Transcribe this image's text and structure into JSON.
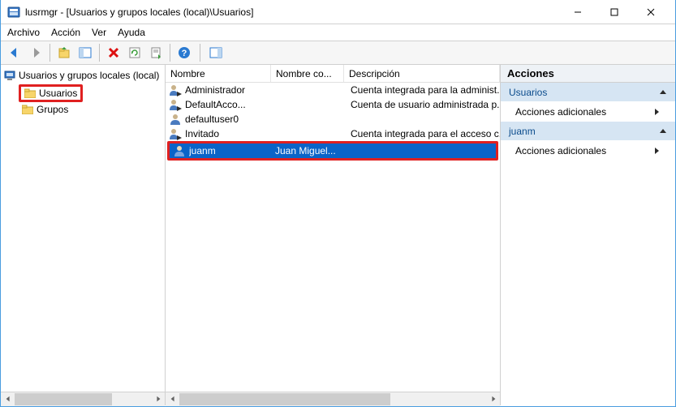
{
  "window": {
    "title": "lusrmgr - [Usuarios y grupos locales (local)\\Usuarios]"
  },
  "menu": {
    "file": "Archivo",
    "action": "Acción",
    "view": "Ver",
    "help": "Ayuda"
  },
  "tree": {
    "root": "Usuarios y grupos locales (local)",
    "users": "Usuarios",
    "groups": "Grupos"
  },
  "list": {
    "columns": {
      "name": "Nombre",
      "fullname": "Nombre co...",
      "description": "Descripción"
    },
    "rows": [
      {
        "name": "Administrador",
        "fullname": "",
        "description": "Cuenta integrada para la administ..",
        "icon": "user-down"
      },
      {
        "name": "DefaultAcco...",
        "fullname": "",
        "description": "Cuenta de usuario administrada p..",
        "icon": "user-down"
      },
      {
        "name": "defaultuser0",
        "fullname": "",
        "description": "",
        "icon": "user"
      },
      {
        "name": "Invitado",
        "fullname": "",
        "description": "Cuenta integrada para el acceso c..",
        "icon": "user-down"
      },
      {
        "name": "juanm",
        "fullname": "Juan Miguel...",
        "description": "",
        "icon": "user",
        "selected": true
      }
    ]
  },
  "actions": {
    "title": "Acciones",
    "section1": "Usuarios",
    "additional": "Acciones adicionales",
    "section2": "juanm"
  }
}
